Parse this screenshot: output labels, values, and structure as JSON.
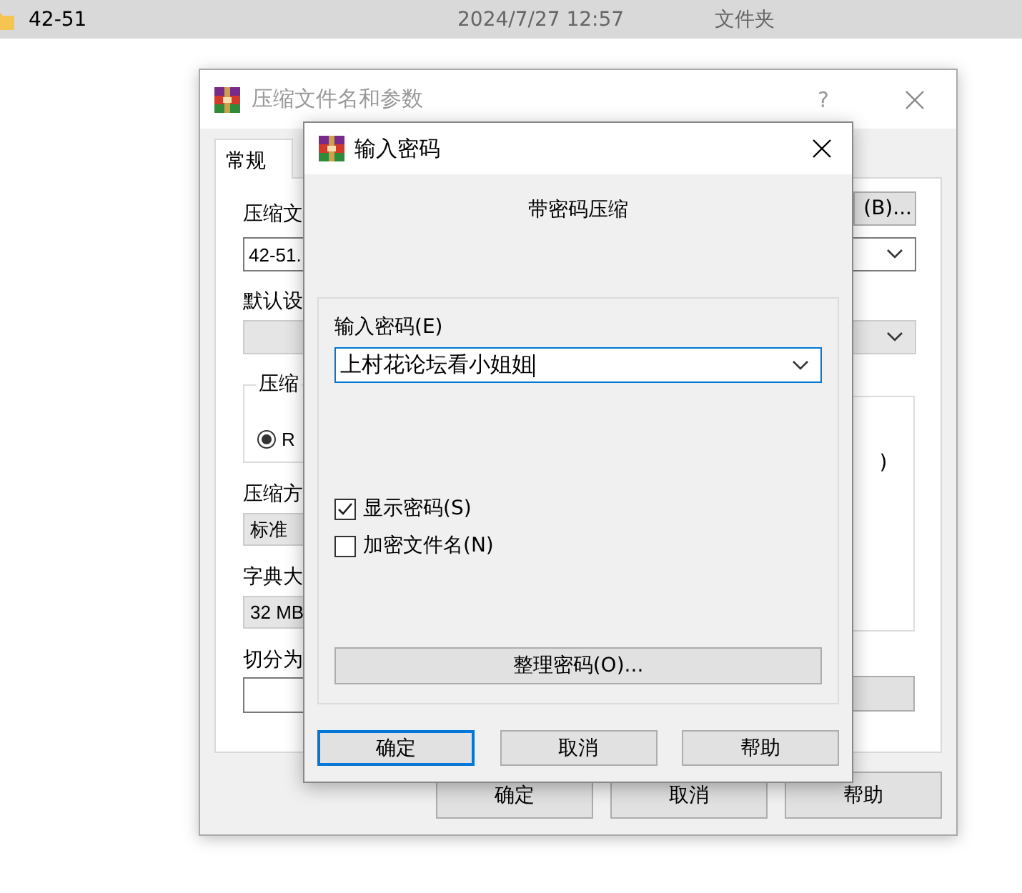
{
  "file_row": {
    "name": "42-51",
    "date": "2024/7/27 12:57",
    "type": "文件夹",
    "selected": true
  },
  "back_dialog": {
    "title": "压缩文件名和参数",
    "help_button": "?",
    "active": false,
    "tabs": [
      {
        "label": "常规",
        "selected": true
      }
    ],
    "archive_name": {
      "label": "压缩文",
      "value": "42-51."
    },
    "browse_button": "(B)...",
    "profile": {
      "label": "默认设"
    },
    "format_group": {
      "label": "压缩",
      "options": [
        {
          "label": "R",
          "selected": true
        }
      ]
    },
    "options_group": {
      "text": ")"
    },
    "method": {
      "label": "压缩方",
      "value": "标准"
    },
    "dictionary": {
      "label": "字典大",
      "value": "32 MB"
    },
    "split": {
      "label": "切分为"
    },
    "buttons": [
      "确定",
      "取消",
      "帮助"
    ]
  },
  "password_dialog": {
    "title": "输入密码",
    "heading": "带密码压缩",
    "password": {
      "label": "输入密码(E)",
      "value": "上村花论坛看小姐姐",
      "focused": true
    },
    "options": [
      {
        "label": "显示密码(S)",
        "checked": true
      },
      {
        "label": "加密文件名(N)",
        "checked": false
      }
    ],
    "organize_button": "整理密码(O)...",
    "buttons": [
      {
        "label": "确定",
        "default": true
      },
      {
        "label": "取消",
        "default": false
      },
      {
        "label": "帮助",
        "default": false
      }
    ]
  }
}
